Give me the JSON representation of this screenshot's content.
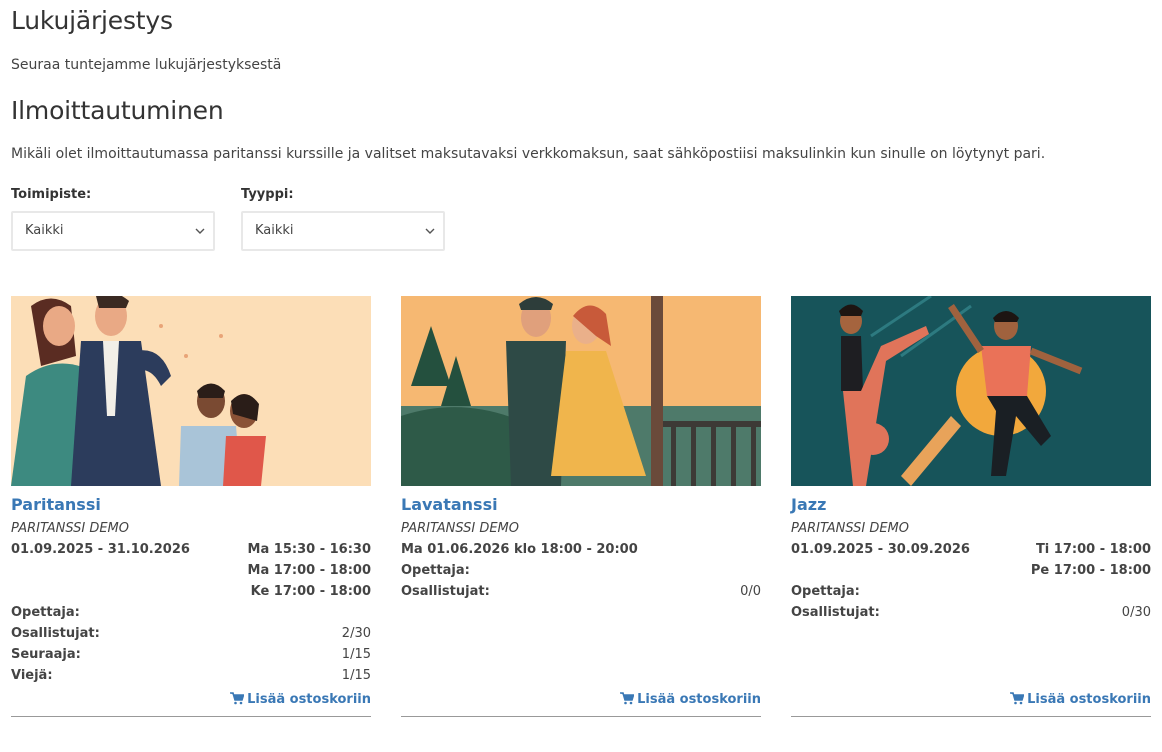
{
  "page": {
    "title": "Lukujärjestys",
    "subtitle": "Seuraa tuntejamme lukujärjestyksestä",
    "section_title": "Ilmoittautuminen",
    "notice": "Mikäli olet ilmoittautumassa paritanssi kurssille ja valitset maksutavaksi verkkomaksun, saat sähköpostiisi maksulinkin kun sinulle on löytynyt pari."
  },
  "filters": {
    "office": {
      "label": "Toimipiste:",
      "value": "Kaikki"
    },
    "type": {
      "label": "Tyyppi:",
      "value": "Kaikki"
    }
  },
  "cards": [
    {
      "title": "Paritanssi",
      "subtitle": "PARITANSSI DEMO",
      "dates": "01.09.2025 - 31.10.2026",
      "times": [
        "Ma 15:30 - 16:30",
        "Ma 17:00 - 18:00",
        "Ke 17:00 - 18:00"
      ],
      "teacher_label": "Opettaja:",
      "participants_label": "Osallistujat:",
      "participants": "2/30",
      "follower_label": "Seuraaja:",
      "follower": "1/15",
      "leader_label": "Viejä:",
      "leader": "1/15",
      "cart_label": "Lisää ostoskoriin"
    },
    {
      "title": "Lavatanssi",
      "subtitle": "PARITANSSI DEMO",
      "dates": "Ma 01.06.2026 klo 18:00 - 20:00",
      "teacher_label": "Opettaja:",
      "participants_label": "Osallistujat:",
      "participants": "0/0",
      "cart_label": "Lisää ostoskoriin"
    },
    {
      "title": "Jazz",
      "subtitle": "PARITANSSI DEMO",
      "dates": "01.09.2025 - 30.09.2026",
      "times": [
        "Ti 17:00 - 18:00",
        "Pe 17:00 - 18:00"
      ],
      "teacher_label": "Opettaja:",
      "participants_label": "Osallistujat:",
      "participants": "0/30",
      "cart_label": "Lisää ostoskoriin"
    }
  ],
  "icons": {
    "cart": "shopping-cart-icon",
    "select_arrow": "chevron-down-icon"
  },
  "colors": {
    "link": "#3a78b5",
    "text": "#333333"
  }
}
